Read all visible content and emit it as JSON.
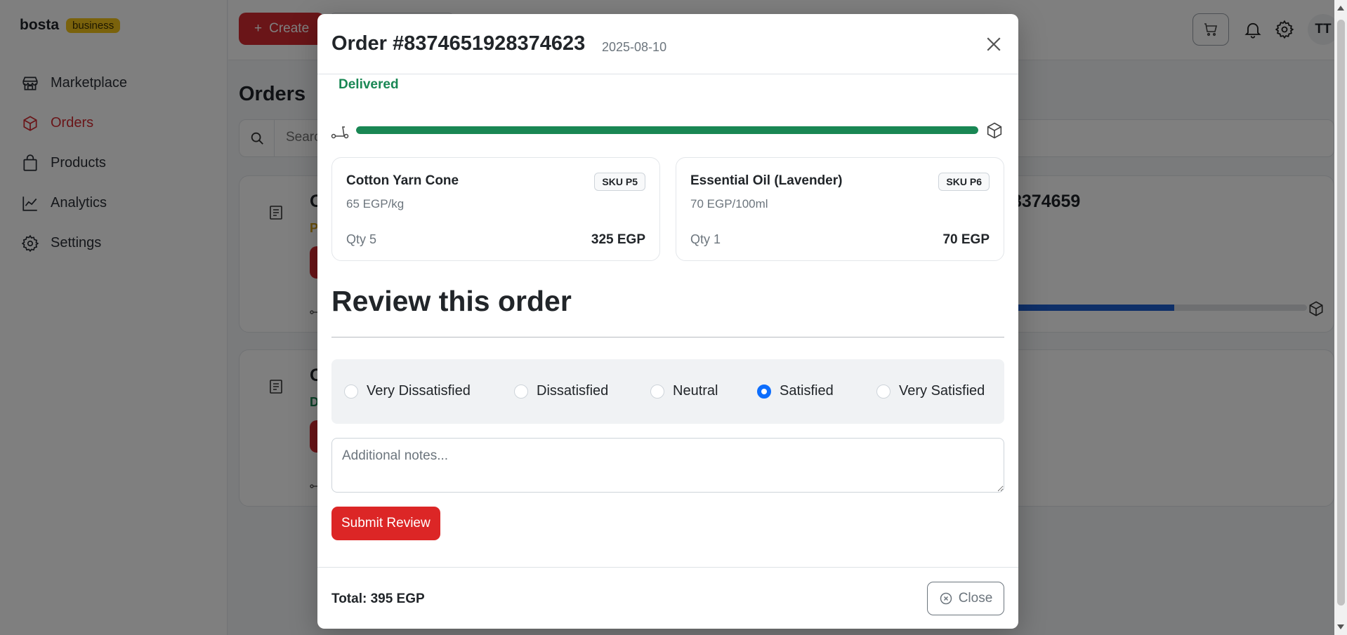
{
  "app": {
    "brand": "bosta",
    "brand_badge": "business",
    "nav": [
      {
        "label": "Marketplace",
        "icon": "store-icon"
      },
      {
        "label": "Orders",
        "icon": "cube-icon",
        "active": true
      },
      {
        "label": "Products",
        "icon": "bag-icon"
      },
      {
        "label": "Analytics",
        "icon": "chart-line-icon"
      },
      {
        "label": "Settings",
        "icon": "gear-icon"
      }
    ],
    "create_label": "Create",
    "avatar_initials": "TT",
    "page_title": "Orders",
    "search_placeholder": "Search",
    "bg_card1": {
      "title": "O",
      "title_suffix": "8374659",
      "status": "P"
    },
    "bg_card2": {
      "title": "O",
      "status": "D"
    }
  },
  "modal": {
    "title": "Order #8374651928374623",
    "date": "2025-08-10",
    "status": "Delivered",
    "progress_percent": 100,
    "items": [
      {
        "name": "Cotton Yarn Cone",
        "sku": "SKU P5",
        "unit_price": "65 EGP/kg",
        "qty": "Qty 5",
        "total": "325 EGP"
      },
      {
        "name": "Essential Oil (Lavender)",
        "sku": "SKU P6",
        "unit_price": "70 EGP/100ml",
        "qty": "Qty 1",
        "total": "70 EGP"
      }
    ],
    "review": {
      "heading": "Review this order",
      "options": [
        "Very Dissatisfied",
        "Dissatisfied",
        "Neutral",
        "Satisfied",
        "Very Satisfied"
      ],
      "selected": "Satisfied",
      "notes_placeholder": "Additional notes...",
      "submit_label": "Submit Review"
    },
    "footer_total": "Total: 395 EGP",
    "close_label": "Close"
  },
  "colors": {
    "brand_red": "#d42a30",
    "delivered_green": "#198754",
    "radio_blue": "#0d6efd",
    "progress_blue": "#1d5fd1",
    "badge_yellow": "#f5c518"
  }
}
